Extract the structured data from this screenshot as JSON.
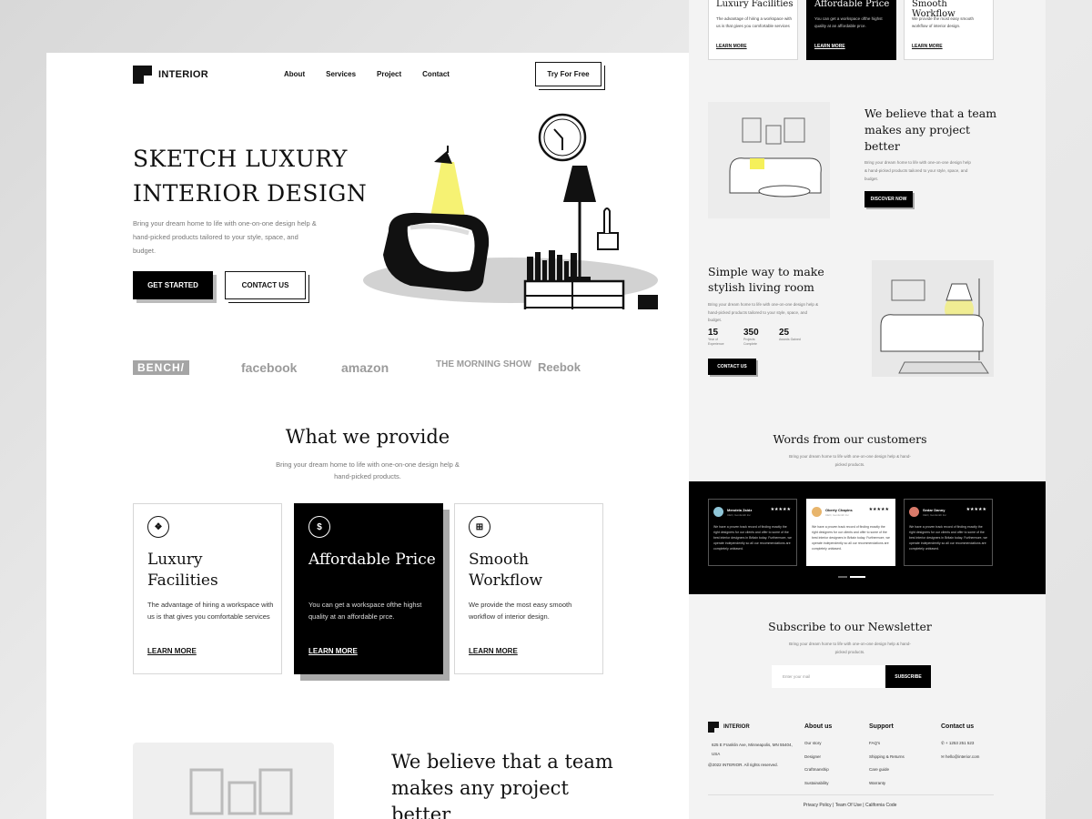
{
  "brand": {
    "name": "INTERIOR"
  },
  "nav": {
    "links": [
      "About",
      "Services",
      "Project",
      "Contact"
    ],
    "cta": "Try For Free"
  },
  "hero": {
    "title": "SKETCH LUXURY INTERIOR DESIGN",
    "text": "Bring your dream home to life with one-on-one design help & hand-picked products tailored to your style, space, and budget.",
    "primary_btn": "GET STARTED",
    "secondary_btn": "CONTACT US"
  },
  "brands": [
    "BENCH/",
    "facebook",
    "amazon",
    "THE MORNING SHOW",
    "Reebok"
  ],
  "provide": {
    "title": "What we provide",
    "subtitle": "Bring your dream home to life with one-on-one design help & hand-picked products.",
    "cards": [
      {
        "title": "Luxury Facilities",
        "text": "The advantage of hiring a workspace with us is that gives you comfortable services",
        "link": "LEARN MORE",
        "icon": "diamond-grid-icon"
      },
      {
        "title": "Affordable Price",
        "text": "You can get a workspace ofthe highst quality at an affordable prce.",
        "link": "LEARN MORE",
        "icon": "dollar-icon"
      },
      {
        "title": "Smooth Workflow",
        "text": "We provide the most easy smooth workflow of interior design.",
        "link": "LEARN MORE",
        "icon": "windows-icon"
      }
    ]
  },
  "believe": {
    "title": "We believe that a team makes any project better",
    "text": "Bring your dream home to life with one-on-one design help & hand-picked products tailored to your style, space, and budget.",
    "btn": "DISCOVER NOW"
  },
  "simple": {
    "title": "Simple way to make stylish living room",
    "text": "Bring your dream home to life with one-on-one design help & hand-picked products tailored to your style, space, and budget.",
    "stats": [
      {
        "value": "15",
        "label": "Year of Experience"
      },
      {
        "value": "350",
        "label": "Projects Complete"
      },
      {
        "value": "25",
        "label": "Awards Gained"
      }
    ],
    "btn": "CONTACT US"
  },
  "customers": {
    "title": "Words from our customers",
    "subtitle": "Bring your dream home to life with one-on-one design help & hand-picked products.",
    "testimonials": [
      {
        "name": "Mendela Zaidz",
        "role": "CEO, Gonlsmth Inc",
        "stars": "★★★★★",
        "text": "We have a proven track record of finding exactly the right designers for our clients and offer to some of the best interior designers in Britain today. Furthermore, we operate independently so all our recommendations are completely unbiased."
      },
      {
        "name": "Oberty Chapins",
        "role": "CEO, Gonlsmth Inc",
        "stars": "★★★★★",
        "text": "We have a proven track record of finding exactly the right designers for our clients and offer to some of the best interior designers in Britain today. Furthermore, we operate independently so all our recommendations are completely unbiased."
      },
      {
        "name": "Sedar Danny",
        "role": "CEO, Gonlsmth Inc",
        "stars": "★★★★★",
        "text": "We have a proven track record of finding exactly the right designers for our clients and offer to some of the best interior designers in Britain today. Furthermore, we operate independently so all our recommendations are completely unbiased."
      }
    ]
  },
  "newsletter": {
    "title": "Subscribe to our Newsletter",
    "subtitle": "Bring your dream home to life with one-on-one design help & hand-picked products.",
    "placeholder": "Enter your mail",
    "btn": "SUBSCRIBE"
  },
  "footer": {
    "address": "625 E Franklin Ave, Minneapolis, MN 55404, USA",
    "copyright": "@2022 INTERIOR. All rights reserved.",
    "about": {
      "heading": "About us",
      "items": [
        "Our story",
        "Designer",
        "Craftmanship",
        "Sustainability"
      ]
    },
    "support": {
      "heading": "Support",
      "items": [
        "FAQ's",
        "Shipping & Returns",
        "Care guide",
        "Warranty"
      ]
    },
    "contact": {
      "heading": "Contact us",
      "phone": "+ 1253 251 523",
      "email": "hello@interior.com"
    },
    "legal": [
      "Privacy Policy",
      "Team Of Use",
      "California Code"
    ]
  },
  "colors": {
    "accent_yellow": "#f5f05a",
    "dark": "#000000",
    "muted": "#777777"
  }
}
